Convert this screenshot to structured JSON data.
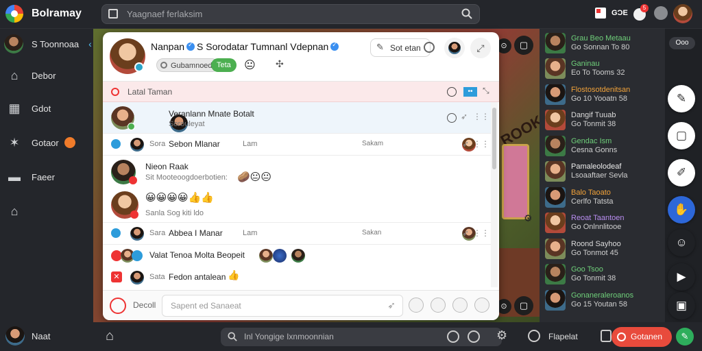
{
  "app": {
    "title": "Bolramay"
  },
  "search": {
    "placeholder": "Yaagnaef ferlaksim"
  },
  "topbar": {
    "badge_count": "5",
    "status_text": "GƆE"
  },
  "sidebar": {
    "profile_name": "S Toonnoaa",
    "items": [
      {
        "label": "Debor",
        "icon": "home-icon"
      },
      {
        "label": "Gdot",
        "icon": "grid-icon"
      },
      {
        "label": "Gotaor",
        "icon": "star-icon",
        "badge": "•"
      },
      {
        "label": "Faeer",
        "icon": "sofa-icon"
      },
      {
        "label": "",
        "icon": "store-icon"
      }
    ],
    "footer_name": "Naat"
  },
  "panel": {
    "title": "Nanpan",
    "title_rest": "S Sorodatar Tumnanl Vdepnan",
    "tags": [
      "Gubamnoed",
      "Teta"
    ],
    "open_button": "Sot etan",
    "latest_label": "Latal Taman",
    "latest_badge": "••",
    "messages": [
      {
        "name": "Veranlann Mnate Botalt",
        "sub": "Sorouleyat",
        "time": ""
      },
      {
        "prefix": "Sora",
        "name": "Sebon Mlanar",
        "mid": "Lam",
        "right": "Sakam"
      },
      {
        "name": "Nieon Raak",
        "sub": "Sit Mooteoogdoerbotien:",
        "emojis": "🥔😐😐"
      },
      {
        "emojis": "😀😀😀😀👍👍",
        "sub": "Sanla Sog kiti ldo"
      },
      {
        "prefix": "Sara",
        "name": "Abbea I Manar",
        "mid": "Lam",
        "right": "Sakan"
      },
      {
        "name": "Valat Tenoa Molta Beopeit"
      },
      {
        "prefix": "Sata",
        "name": "Fedon antalean",
        "emojis": "👍"
      }
    ],
    "composer": {
      "label": "Decoll",
      "placeholder": "Sapent ed Sanaeat"
    }
  },
  "right_list": [
    {
      "name": "Grau Beo Metaau",
      "sub": "Go Sonnan To 80",
      "color": "#6fcf7a"
    },
    {
      "name": "Ganinau",
      "sub": "Eo To Tooms 32",
      "color": "#6fcf7a"
    },
    {
      "name": "Flostosotdenitsan",
      "sub": "Go 10 Yooatn 58",
      "color": "#f2a33a"
    },
    {
      "name": "Dangif Tuuab",
      "sub": "Go Tonmit 38",
      "color": "#dcdcdc"
    },
    {
      "name": "Gendac Ism",
      "sub": "Cesna Gonns",
      "color": "#6fcf7a"
    },
    {
      "name": "Pamaleolodeaf",
      "sub": "Lsoaaftaer Sevla",
      "color": "#ececec"
    },
    {
      "name": "Balo Taoato",
      "sub": "Cerlfo Tatsta",
      "color": "#f2a33a"
    },
    {
      "name": "Reoat Taantoen",
      "sub": "Go Onlnnlitooe",
      "color": "#b88df0"
    },
    {
      "name": "Roond Sayhoo",
      "sub": "Go Tonmot 45",
      "color": "#dcdcdc"
    },
    {
      "name": "Goo Tsoo",
      "sub": "Go Tonmit 38",
      "color": "#6fcf7a"
    },
    {
      "name": "Gonaneraleroanos",
      "sub": "Go 15 Youtan 58",
      "color": "#6fcf7a"
    }
  ],
  "right_header": {
    "pill": "Ooo"
  },
  "bottombar": {
    "search_placeholder": "Inl Yongige Ixnmoonnian",
    "label": "Flapelat",
    "action": "Gotanen"
  },
  "game": {
    "sign": "ROOK"
  }
}
